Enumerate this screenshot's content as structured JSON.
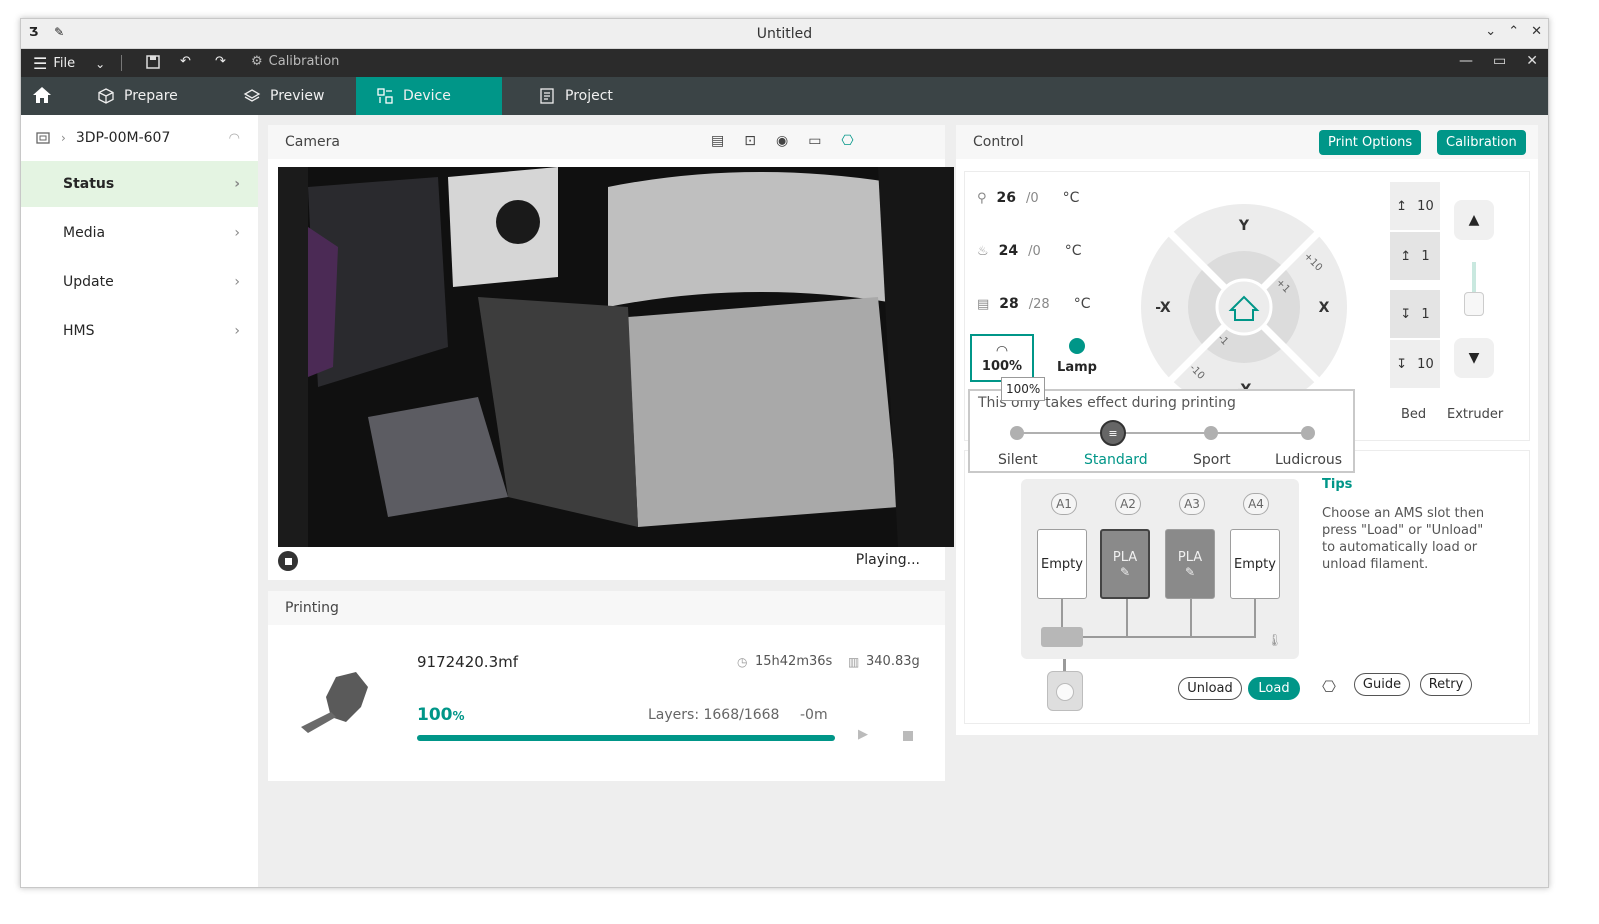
{
  "window": {
    "title": "Untitled",
    "titlebar_icons": [
      "app-icon",
      "pin-icon"
    ]
  },
  "menu": {
    "file_label": "File",
    "calibration_label": "Calibration"
  },
  "tabs": [
    {
      "label": "Prepare"
    },
    {
      "label": "Preview"
    },
    {
      "label": "Device"
    },
    {
      "label": "Project"
    }
  ],
  "device": {
    "name": "3DP-00M-607"
  },
  "sidebar": {
    "items": [
      {
        "label": "Status"
      },
      {
        "label": "Media"
      },
      {
        "label": "Update"
      },
      {
        "label": "HMS"
      }
    ]
  },
  "camera": {
    "title": "Camera",
    "status": "Playing..."
  },
  "printing": {
    "title": "Printing",
    "file": "9172420.3mf",
    "time": "15h42m36s",
    "weight": "340.83g",
    "progress_pct": 100,
    "progress_label": "100",
    "progress_unit": "%",
    "layers": "Layers: 1668/1668",
    "remaining": "-0m"
  },
  "control": {
    "title": "Control",
    "print_options": "Print Options",
    "calibration": "Calibration",
    "temps": [
      {
        "current": "26",
        "target": "/0",
        "unit": "°C"
      },
      {
        "current": "24",
        "target": "/0",
        "unit": "°C"
      },
      {
        "current": "28",
        "target": "/28",
        "unit": "°C"
      }
    ],
    "speed_label": "100%",
    "lamp_label": "Lamp",
    "tooltip": "100%",
    "jog": {
      "y_plus": "Y",
      "y_minus": "-Y",
      "x_plus": "X",
      "x_minus": "-X",
      "d10a": "+10",
      "d1a": "+1",
      "d1b": "-1",
      "d10b": "-10"
    },
    "bed_steps": [
      "10",
      "1",
      "1",
      "10"
    ],
    "bed_label": "Bed",
    "extruder_label": "Extruder"
  },
  "speed_popup": {
    "note": "This only takes effect during printing",
    "modes": [
      "Silent",
      "Standard",
      "Sport",
      "Ludicrous"
    ],
    "selected": "Standard"
  },
  "ams": {
    "slots": [
      {
        "id": "A1",
        "label": "Empty"
      },
      {
        "id": "A2",
        "label": "PLA"
      },
      {
        "id": "A3",
        "label": "PLA"
      },
      {
        "id": "A4",
        "label": "Empty"
      }
    ],
    "tips_title": "Tips",
    "tips_text": "Choose an AMS slot then press \"Load\" or \"Unload\" to automatically load or unload filament.",
    "unload": "Unload",
    "load": "Load",
    "guide": "Guide",
    "retry": "Retry"
  },
  "colors": {
    "accent": "#009688",
    "dark_bar": "#2b2b2b",
    "tab_bar": "#3b4446",
    "sidebar_active": "#e4f4e2"
  }
}
